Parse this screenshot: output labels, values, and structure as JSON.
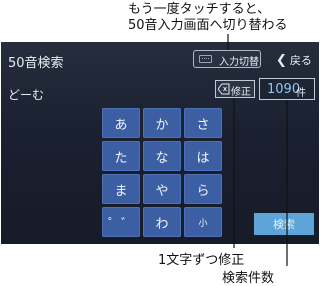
{
  "callouts": {
    "mode_switch_line1": "もう一度タッチすると、",
    "mode_switch_line2": "50音入力画面へ切り替わる",
    "delete": "1文字ずつ修正",
    "count": "検索件数"
  },
  "header": {
    "title": "50音検索",
    "mode_button_label": "入力切替",
    "back_label": "戻る"
  },
  "input": {
    "query": "どーむ",
    "delete_label": "修正",
    "count_value": "1090",
    "count_unit": "件"
  },
  "keyboard": {
    "keys": [
      "あ",
      "か",
      "さ",
      "た",
      "な",
      "は",
      "ま",
      "や",
      "ら",
      "゜゛",
      "わ",
      "小"
    ]
  },
  "search_button_label": "検索",
  "colors": {
    "screen_bg": "#1b2232",
    "key_bg": "#3c5ea3",
    "search_button": "#5ea4d8",
    "count_text": "#8ec6f2"
  }
}
